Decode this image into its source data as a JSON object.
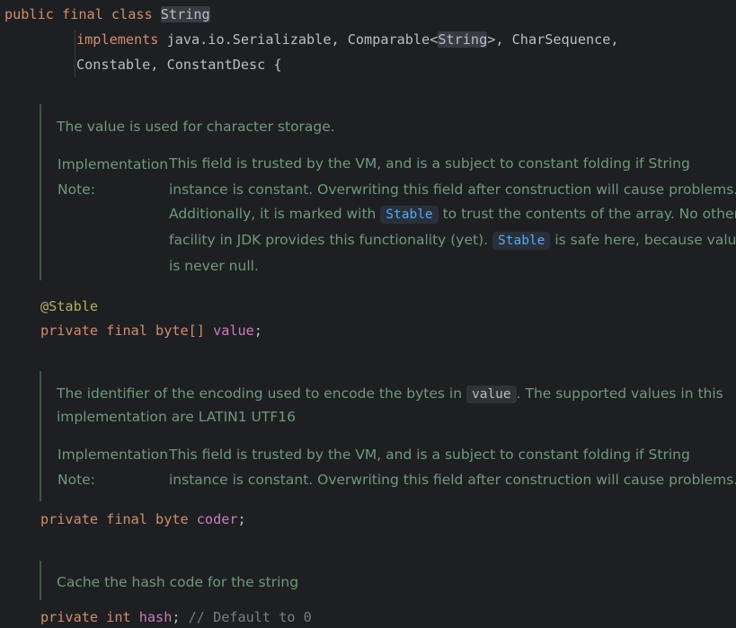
{
  "decl": {
    "public": "public",
    "final": "final",
    "class": "class",
    "name": "String",
    "implements": "implements",
    "ifaces_1": "java.io.Serializable, ",
    "comparable": "Comparable<",
    "comparable_arg": "String",
    "ifaces_1_tail": ">, CharSequence,",
    "ifaces_2": "Constable, ConstantDesc {"
  },
  "doc_value": {
    "summary": "The value is used for character storage.",
    "impl_label_1": "Implementation",
    "impl_label_2": "Note:",
    "body_line_1": "This field is trusted by the VM, and is a subject to constant folding if String",
    "body_line_2": "instance is constant. Overwriting this field after construction will cause problems.",
    "body_line_3_pre": "Additionally, it is marked with ",
    "chip_stable_1": "Stable",
    "body_line_3_post": " to trust the contents of the array. No other",
    "body_line_4_pre": "facility in JDK provides this functionality (yet). ",
    "chip_stable_2": "Stable",
    "body_line_4_post": " is safe here, because value",
    "body_line_5": "is never null."
  },
  "field_value": {
    "annotation": "@Stable",
    "private": "private",
    "final": "final",
    "type": "byte[]",
    "name": "value",
    "semi": ";"
  },
  "doc_coder": {
    "summary_pre": "The identifier of the encoding used to encode the bytes in ",
    "chip_value": "value",
    "summary_post": ". The supported values in this",
    "summary_line_2": "implementation are LATIN1 UTF16",
    "impl_label_1": "Implementation",
    "impl_label_2": "Note:",
    "body_line_1": "This field is trusted by the VM, and is a subject to constant folding if String",
    "body_line_2": "instance is constant. Overwriting this field after construction will cause problems."
  },
  "field_coder": {
    "private": "private",
    "final": "final",
    "type": "byte",
    "name": "coder",
    "semi": ";"
  },
  "doc_hash": {
    "summary": "Cache the hash code for the string"
  },
  "field_hash": {
    "private": "private",
    "type": "int",
    "name": "hash",
    "semi": ";",
    "comment": " // Default to 0"
  }
}
